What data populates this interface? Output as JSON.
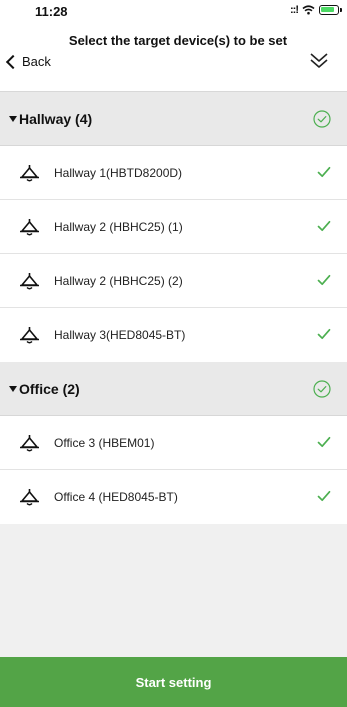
{
  "status_bar": {
    "time": "11:28",
    "signal": "::!",
    "icons": [
      "signal-icon",
      "wifi-icon",
      "battery-icon"
    ]
  },
  "nav": {
    "back_label": "Back",
    "title": "Select the target device(s) to be set",
    "collapse_icon": "double-chevron-down-icon"
  },
  "colors": {
    "accent": "#53a447",
    "check": "#4caf50",
    "group_background": "#e9e9e9",
    "row_background": "#ffffff"
  },
  "groups": [
    {
      "title": "Hallway (4)",
      "all_selected": true,
      "devices": [
        {
          "label": "Hallway 1(HBTD8200D)",
          "selected": true
        },
        {
          "label": "Hallway 2 (HBHC25) (1)",
          "selected": true
        },
        {
          "label": "Hallway 2 (HBHC25) (2)",
          "selected": true
        },
        {
          "label": "Hallway 3(HED8045-BT)",
          "selected": true
        }
      ]
    },
    {
      "title": "Office (2)",
      "all_selected": true,
      "devices": [
        {
          "label": "Office 3 (HBEM01)",
          "selected": true
        },
        {
          "label": "Office 4 (HED8045-BT)",
          "selected": true
        }
      ]
    }
  ],
  "footer": {
    "start_label": "Start setting"
  }
}
